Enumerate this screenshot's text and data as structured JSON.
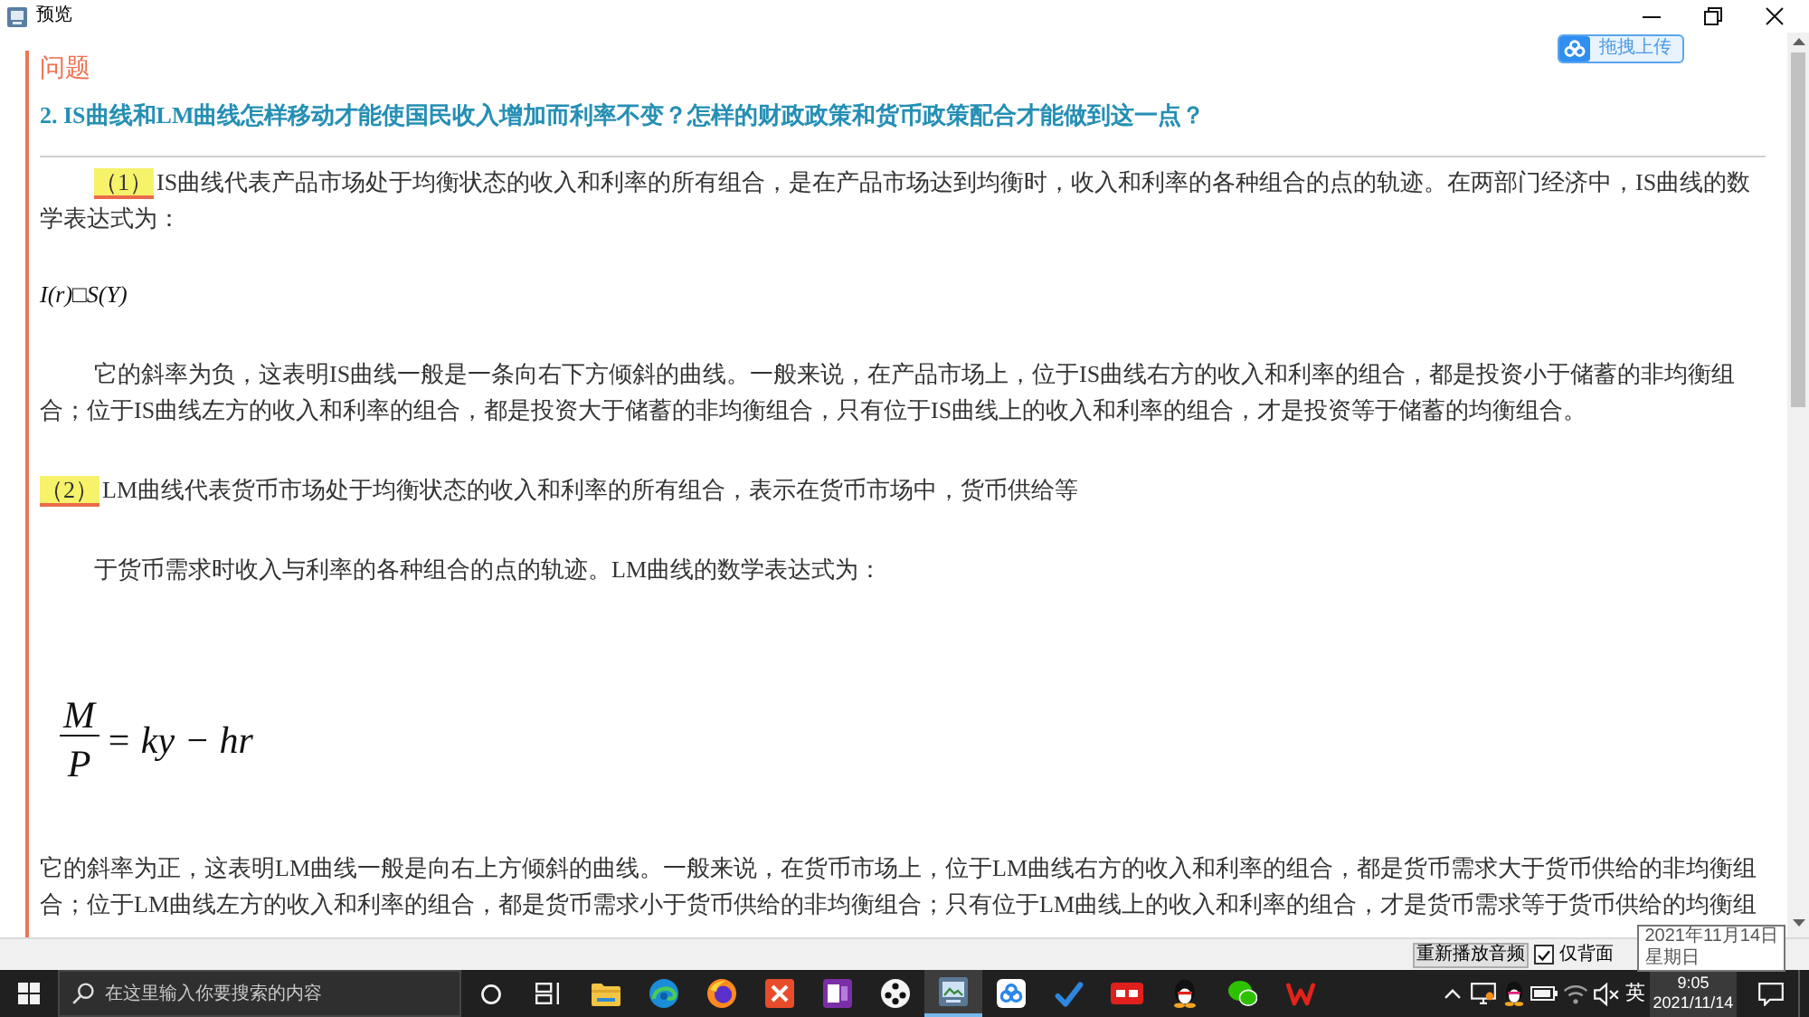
{
  "window": {
    "title": "预览"
  },
  "upload_button": {
    "label": "拖拽上传"
  },
  "question": {
    "label": "问题",
    "title": "2. IS曲线和LM曲线怎样移动才能使国民收入增加而利率不变？怎样的财政政策和货币政策配合才能做到这一点？"
  },
  "answer_blocks": [
    {
      "kind": "indented_paragraph",
      "marker": "（1）",
      "text": "IS曲线代表产品市场处于均衡状态的收入和利率的所有组合，是在产品市场达到均衡时，收入和利率的各种组合的点的轨迹。在两部门经济中，IS曲线的数学表达式为："
    },
    {
      "kind": "formula",
      "text": "I(r)□S(Y)"
    },
    {
      "kind": "indented_paragraph",
      "text": "它的斜率为负，这表明IS曲线一般是一条向右下方倾斜的曲线。一般来说，在产品市场上，位于IS曲线右方的收入和利率的组合，都是投资小于储蓄的非均衡组合；位于IS曲线左方的收入和利率的组合，都是投资大于储蓄的非均衡组合，只有位于IS曲线上的收入和利率的组合，才是投资等于储蓄的均衡组合。"
    },
    {
      "kind": "paragraph",
      "marker": "（2）",
      "text": "LM曲线代表货币市场处于均衡状态的收入和利率的所有组合，表示在货币市场中，货币供给等"
    },
    {
      "kind": "indented_paragraph",
      "text": "于货币需求时收入与利率的各种组合的点的轨迹。LM曲线的数学表达式为："
    },
    {
      "kind": "fraction",
      "numerator": "M",
      "denominator": "P",
      "expression": "= ky − hr"
    },
    {
      "kind": "paragraph",
      "text": "它的斜率为正，这表明LM曲线一般是向右上方倾斜的曲线。一般来说，在货币市场上，位于LM曲线右方的收入和利率的组合，都是货币需求大于货币供给的非均衡组合；位于LM曲线左方的收入和利率的组合，都是货币需求小于货币供给的非均衡组合；只有位于LM曲线上的收入和利率的组合，才是货币需求等于货币供给的均衡组"
    }
  ],
  "bottom_bar": {
    "replay_button": "重新播放音频",
    "back_only": {
      "label": "仅背面",
      "checked": true
    }
  },
  "tooltip": {
    "lines": [
      "2021年11月14日",
      "星期日"
    ]
  },
  "taskbar": {
    "search": {
      "placeholder": "在这里输入你要搜索的内容"
    },
    "apps": [
      {
        "kind": "circle",
        "selected": false
      },
      {
        "kind": "timeline",
        "selected": false
      },
      {
        "kind": "folder",
        "selected": false
      },
      {
        "kind": "swirl",
        "selected": false
      },
      {
        "kind": "fox",
        "selected": false
      },
      {
        "kind": "cross",
        "selected": false
      },
      {
        "kind": "notebook",
        "selected": false
      },
      {
        "kind": "dots",
        "selected": false
      },
      {
        "kind": "viewer",
        "selected": true
      },
      {
        "kind": "cloud",
        "selected": false
      },
      {
        "kind": "check",
        "selected": false
      },
      {
        "kind": "tile",
        "selected": false
      },
      {
        "kind": "penguin",
        "selected": false
      },
      {
        "kind": "chat",
        "selected": false
      },
      {
        "kind": "zigzag",
        "selected": false
      }
    ],
    "ime": "英",
    "clock": {
      "time": "9:05",
      "date": "2021/11/14",
      "hovered": true
    }
  }
}
